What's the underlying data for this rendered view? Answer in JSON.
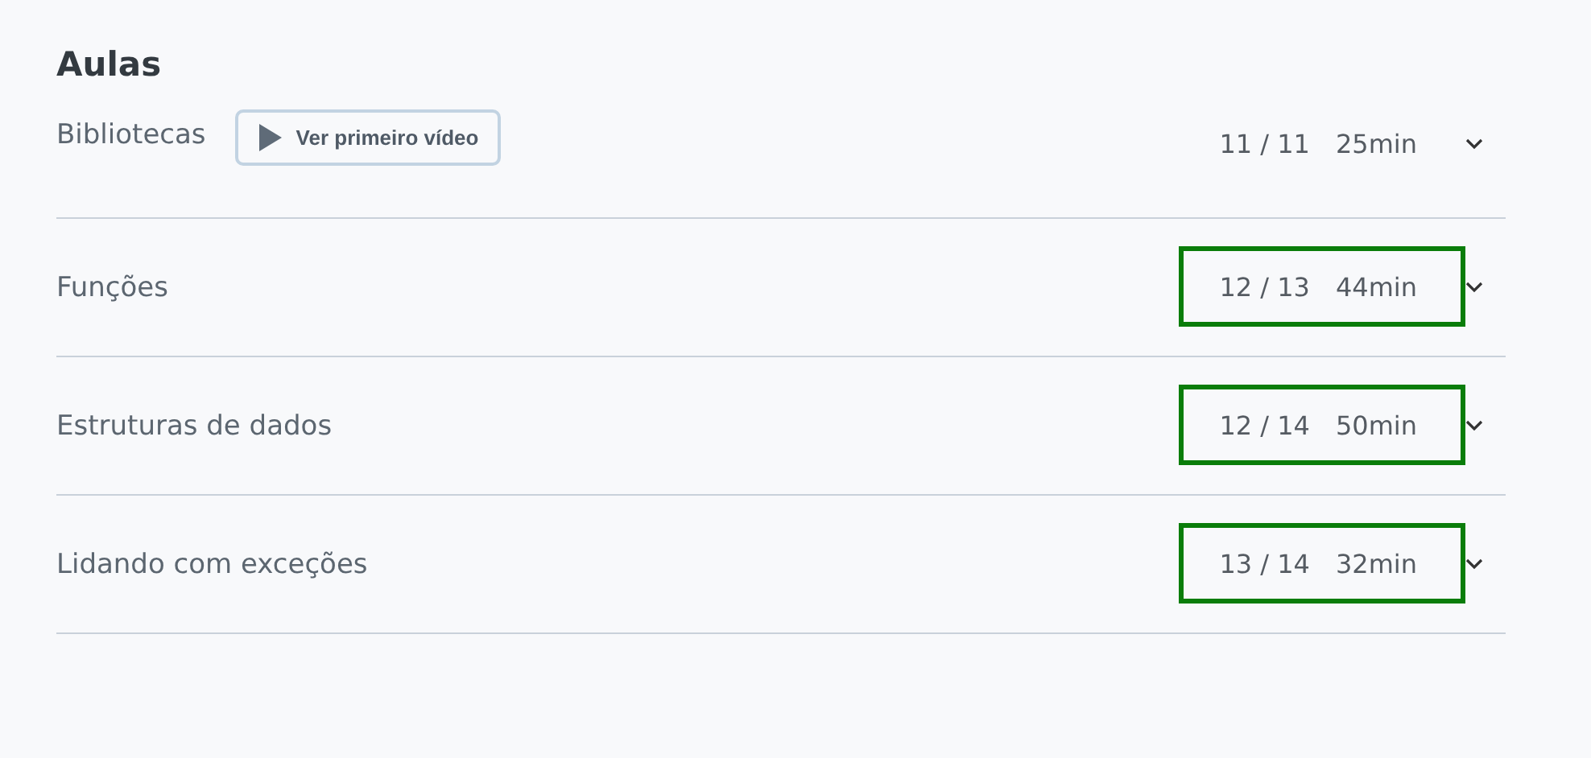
{
  "title": "Aulas",
  "sections": [
    {
      "name": "Bibliotecas",
      "button": "Ver primeiro vídeo",
      "progress": "11 / 11",
      "duration": "25min",
      "highlighted": false
    },
    {
      "name": "Funções",
      "progress": "12 / 13",
      "duration": "44min",
      "highlighted": true
    },
    {
      "name": "Estruturas de dados",
      "progress": "12 / 14",
      "duration": "50min",
      "highlighted": true
    },
    {
      "name": "Lidando com exceções",
      "progress": "13 / 14",
      "duration": "32min",
      "highlighted": true
    }
  ]
}
